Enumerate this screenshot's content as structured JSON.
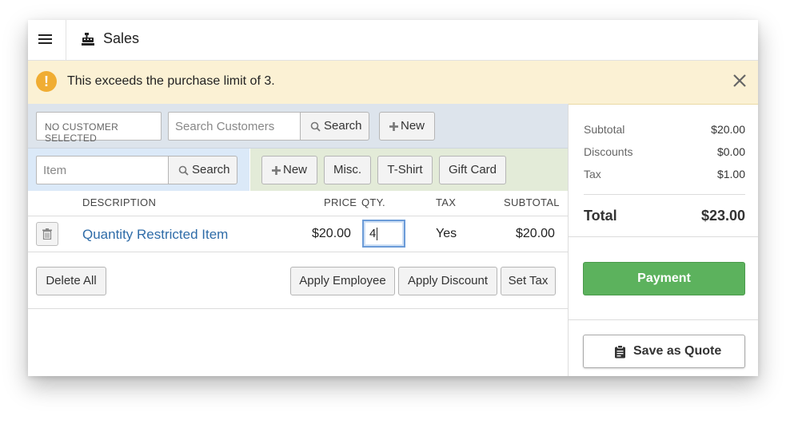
{
  "header": {
    "title": "Sales",
    "menu_icon": "hamburger-icon",
    "app_icon": "cash-register-icon"
  },
  "alert": {
    "message": "This exceeds the purchase limit of 3.",
    "icon": "exclamation-icon",
    "close_icon": "close-icon",
    "color": "#fbf1d4"
  },
  "customer": {
    "selected": "NO CUSTOMER SELECTED",
    "search_placeholder": "Search Customers",
    "search_button": "Search",
    "new_button": "New"
  },
  "item_entry": {
    "placeholder": "Item",
    "search_button": "Search",
    "quick_buttons": [
      "New",
      "Misc.",
      "T-Shirt",
      "Gift Card"
    ]
  },
  "table": {
    "headers": {
      "description": "DESCRIPTION",
      "price": "PRICE",
      "qty": "QTY.",
      "tax": "TAX",
      "subtotal": "SUBTOTAL"
    },
    "rows": [
      {
        "description": "Quantity Restricted Item",
        "price": "$20.00",
        "qty": "4",
        "tax": "Yes",
        "subtotal": "$20.00"
      }
    ]
  },
  "actions": {
    "delete_all": "Delete All",
    "apply_employee": "Apply Employee",
    "apply_discount": "Apply Discount",
    "set_tax": "Set Tax"
  },
  "summary": {
    "subtotal_label": "Subtotal",
    "subtotal": "$20.00",
    "discounts_label": "Discounts",
    "discounts": "$0.00",
    "tax_label": "Tax",
    "tax": "$1.00",
    "total_label": "Total",
    "total": "$23.00"
  },
  "payment_button": "Payment",
  "quote_button": "Save as Quote",
  "colors": {
    "payment": "#5cb25d",
    "link": "#2f6ca8",
    "alert_icon": "#f0ad33"
  }
}
